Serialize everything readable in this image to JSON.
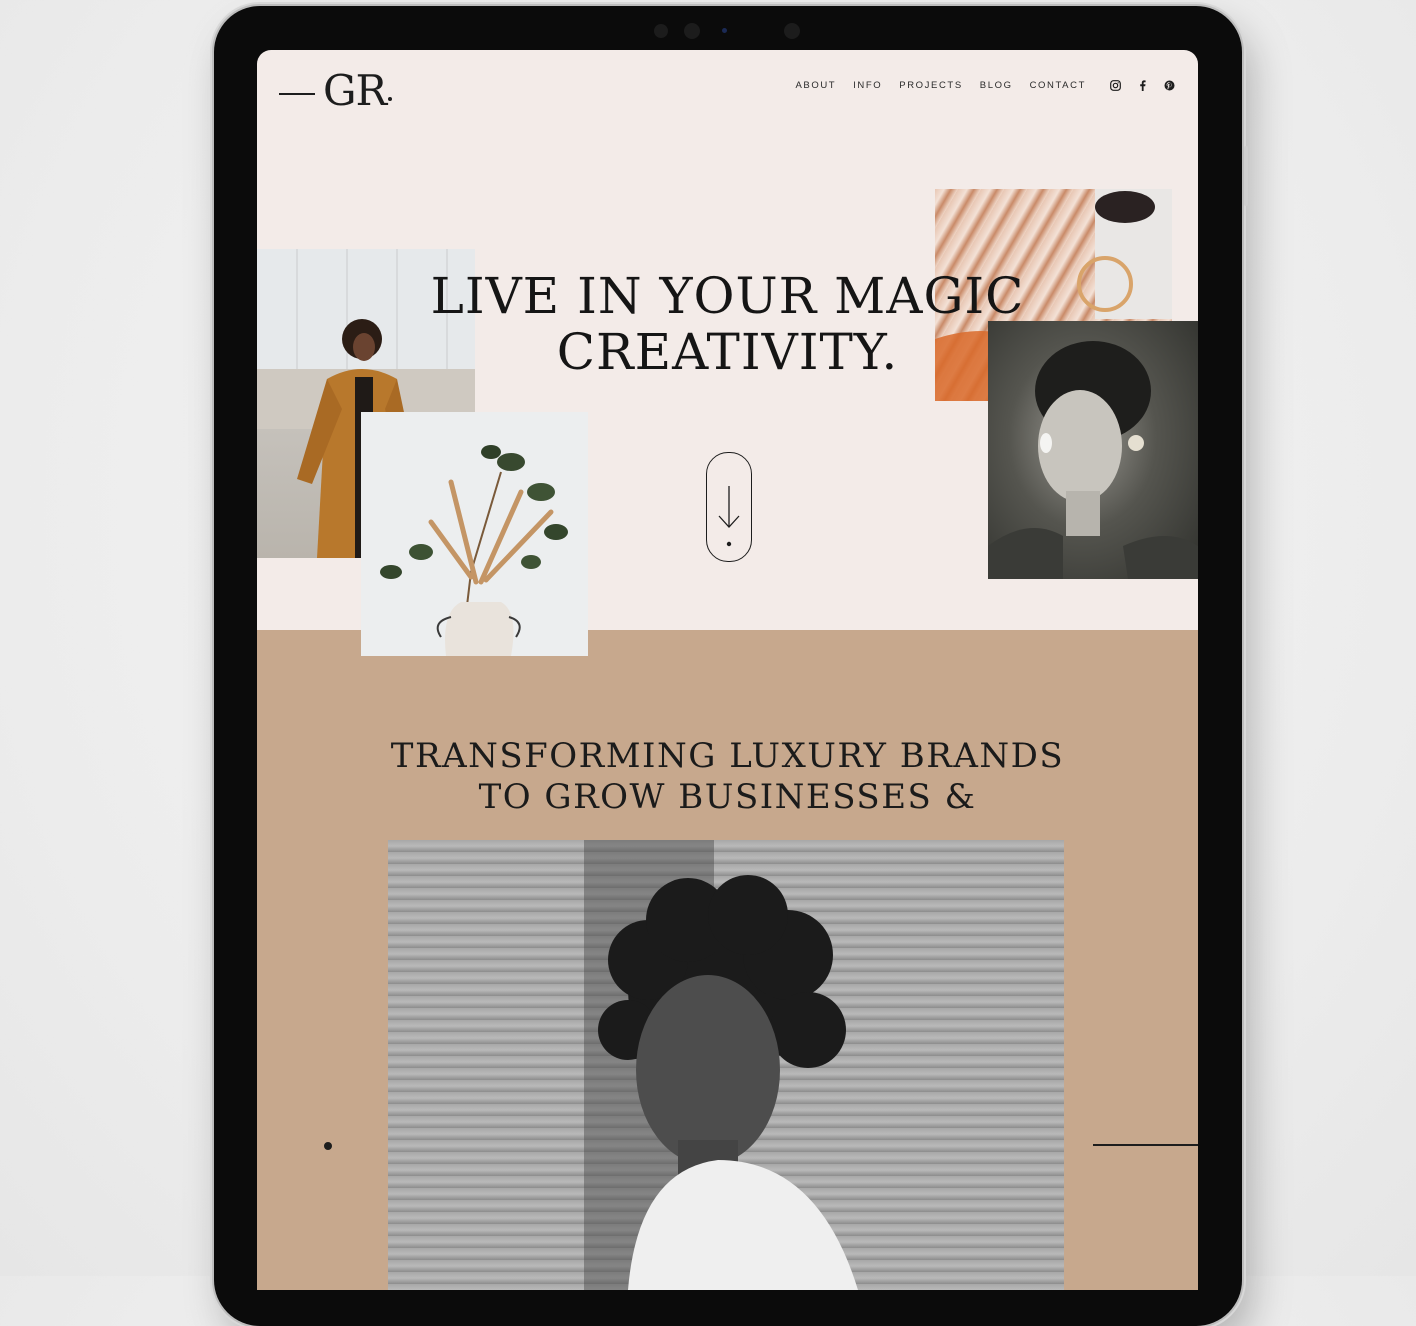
{
  "header": {
    "logo": "GR",
    "nav": [
      "ABOUT",
      "INFO",
      "PROJECTS",
      "BLOG",
      "CONTACT"
    ],
    "social_icons": [
      "instagram-icon",
      "facebook-icon",
      "pinterest-icon"
    ]
  },
  "hero": {
    "line1": "LIVE IN YOUR MAGIC",
    "line2": "CREATIVITY."
  },
  "section": {
    "line1": "TRANSFORMING LUXURY BRANDS",
    "line2": "TO GROW BUSINESSES &"
  },
  "colors": {
    "hero_bg": "#f3ebe8",
    "band_bg": "#c7a88d",
    "ink": "#151515"
  }
}
